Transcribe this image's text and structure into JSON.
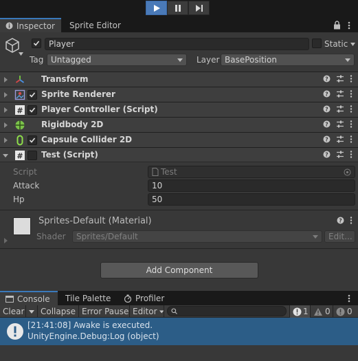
{
  "playbar": {
    "play": "play-icon",
    "pause": "pause-icon",
    "step": "step-icon"
  },
  "inspector_tabs": [
    {
      "label": "Inspector",
      "icon": "info-icon",
      "selected": true
    },
    {
      "label": "Sprite Editor",
      "selected": false
    }
  ],
  "object": {
    "name": "Player",
    "static_label": "Static",
    "tag_label": "Tag",
    "tag_value": "Untagged",
    "layer_label": "Layer",
    "layer_value": "BasePosition"
  },
  "components": [
    {
      "title": "Transform",
      "icon": "transform-icon",
      "has_checkbox": false
    },
    {
      "title": "Sprite Renderer",
      "icon": "sprite-renderer-icon",
      "has_checkbox": true
    },
    {
      "title": "Player Controller (Script)",
      "icon": "script-icon",
      "has_checkbox": true
    },
    {
      "title": "Rigidbody 2D",
      "icon": "rigidbody-icon",
      "has_checkbox": false
    },
    {
      "title": "Capsule Collider 2D",
      "icon": "capsule-collider-icon",
      "has_checkbox": true
    },
    {
      "title": "Test (Script)",
      "icon": "script-icon",
      "has_checkbox": true
    }
  ],
  "test_script": {
    "script_label": "Script",
    "script_value": "Test",
    "attack_label": "Attack",
    "attack_value": "10",
    "hp_label": "Hp",
    "hp_value": "50"
  },
  "material": {
    "title": "Sprites-Default (Material)",
    "shader_label": "Shader",
    "shader_value": "Sprites/Default",
    "edit_label": "Edit..."
  },
  "add_component": "Add Component",
  "console_tabs": [
    {
      "label": "Console",
      "icon": "console-icon",
      "selected": true
    },
    {
      "label": "Tile Palette",
      "selected": false
    },
    {
      "label": "Profiler",
      "icon": "profiler-icon",
      "selected": false
    }
  ],
  "console_toolbar": {
    "clear": "Clear",
    "collapse": "Collapse",
    "error_pause": "Error Pause",
    "editor": "Editor",
    "search_placeholder": "",
    "log_count": "1",
    "warn_count": "0",
    "error_count": "0"
  },
  "log": {
    "line1": "[21:41:08] Awake is executed.",
    "line2": "UnityEngine.Debug:Log (object)"
  }
}
